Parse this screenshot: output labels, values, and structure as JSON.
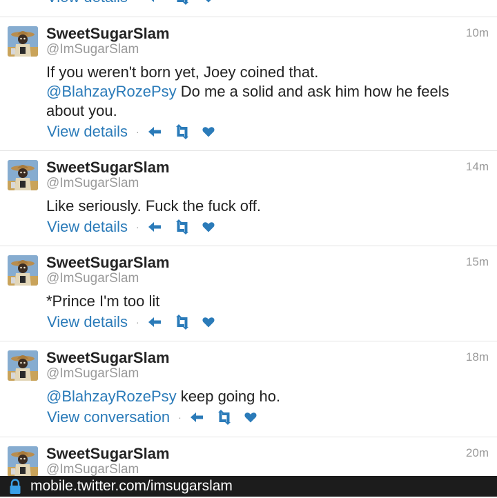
{
  "tweets": [
    {
      "name": "SweetSugarSlam",
      "handle": "@ImSugarSlam",
      "time": "10m",
      "text_parts": [
        "If you weren't born yet, Joey coined that.",
        "@BlahzayRozePsy",
        " Do me a solid and ask him how he feels about you."
      ],
      "link": "View details"
    },
    {
      "name": "SweetSugarSlam",
      "handle": "@ImSugarSlam",
      "time": "14m",
      "text": "Like seriously. Fuck the fuck off.",
      "link": "View details"
    },
    {
      "name": "SweetSugarSlam",
      "handle": "@ImSugarSlam",
      "time": "15m",
      "text": "*Prince I'm too lit",
      "link": "View details"
    },
    {
      "name": "SweetSugarSlam",
      "handle": "@ImSugarSlam",
      "time": "18m",
      "text_parts": [
        "@BlahzayRozePsy",
        " keep going ho."
      ],
      "link": "View conversation"
    },
    {
      "name": "SweetSugarSlam",
      "handle": "@ImSugarSlam",
      "time": "20m"
    }
  ],
  "top_fragment": {
    "link": "View details"
  },
  "separator": "·",
  "icons": [
    "reply-icon",
    "retweet-icon",
    "favorite-icon",
    "lock-icon"
  ],
  "colors": {
    "link": "#2b7bb9",
    "meta": "#9a9a9a",
    "urlbar": "#1c1c1c",
    "lock": "#3aa0e8"
  },
  "urlbar": {
    "url": "mobile.twitter.com/imsugarslam"
  }
}
